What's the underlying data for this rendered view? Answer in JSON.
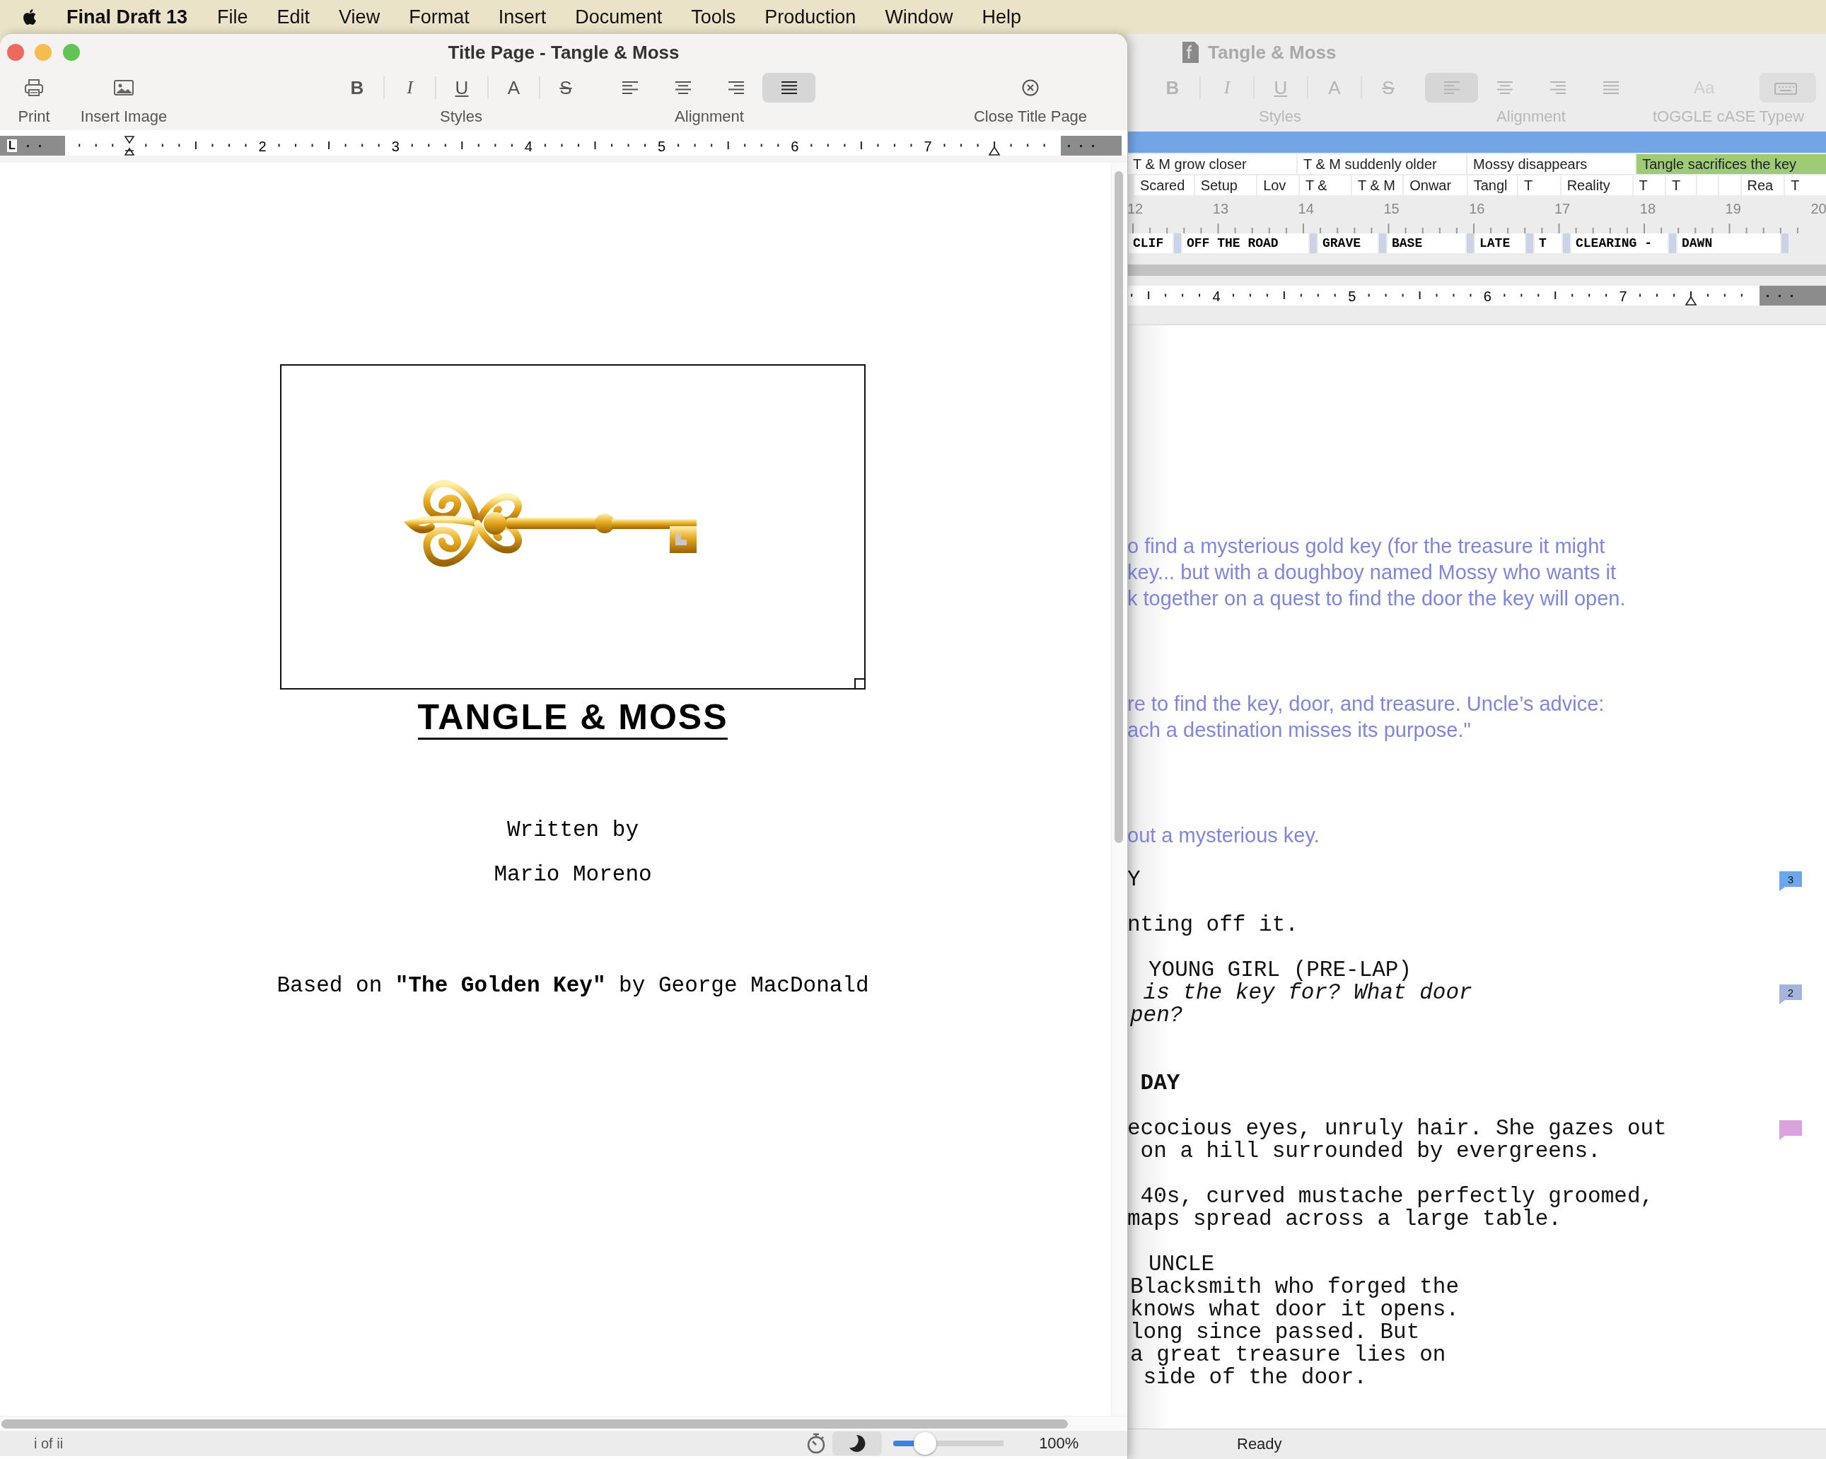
{
  "menu_bar": {
    "app": "Final Draft 13",
    "items": [
      "File",
      "Edit",
      "View",
      "Format",
      "Insert",
      "Document",
      "Tools",
      "Production",
      "Window",
      "Help"
    ]
  },
  "title_window": {
    "title": "Title Page - Tangle & Moss",
    "toolbar": {
      "print": "Print",
      "insert_image": "Insert Image",
      "styles_label": "Styles",
      "styles": [
        "B",
        "I",
        "U",
        "A",
        "S"
      ],
      "alignment_label": "Alignment",
      "alignment": [
        {
          "kind": "left",
          "selected": false
        },
        {
          "kind": "center",
          "selected": false
        },
        {
          "kind": "right",
          "selected": false
        },
        {
          "kind": "justify",
          "selected": true
        }
      ],
      "close": "Close Title Page"
    },
    "ruler": {
      "tab_stop": "L",
      "labels": [
        "2",
        "3",
        "4",
        "5",
        "6",
        "7"
      ]
    },
    "title_page": {
      "title": "TANGLE & MOSS",
      "written_by": "Written by",
      "author": "Mario Moreno",
      "source": "Based on **\"The Golden Key\"** by George MacDonald"
    },
    "status": {
      "page": "i of ii",
      "night_mode": {
        "on": false
      },
      "zoom_slider": {
        "level": 0.29
      },
      "zoom": "100%"
    }
  },
  "script_window": {
    "title": "Tangle & Moss",
    "toolbar": {
      "styles": [
        "B",
        "I",
        "U",
        "A",
        "S"
      ],
      "styles_label": "Styles",
      "alignment": [
        {
          "kind": "left",
          "selected": true
        },
        {
          "kind": "center",
          "selected": false
        },
        {
          "kind": "right",
          "selected": false
        },
        {
          "kind": "justify",
          "selected": false
        }
      ],
      "alignment_label": "Alignment",
      "case_button": "Aa",
      "case_label": "tOGGLE cASE",
      "typewriter_label": "Typew"
    },
    "beats": [
      {
        "label": "T & M grow closer",
        "color": "#ffffff"
      },
      {
        "label": "T & M suddenly older",
        "color": "#ffffff"
      },
      {
        "label": "Mossy disappears",
        "color": "#ffffff"
      },
      {
        "label": "Tangle sacrifices the key",
        "color": "#9dcb76"
      }
    ],
    "cards": [
      {
        "kind": "card",
        "label": "Scared"
      },
      {
        "kind": "card",
        "label": "Setup"
      },
      {
        "kind": "card",
        "label": "Lov"
      },
      {
        "kind": "card",
        "label": "T &"
      },
      {
        "kind": "card",
        "label": "T & M"
      },
      {
        "kind": "card",
        "label": "Onwar"
      },
      {
        "kind": "card",
        "label": "Tangl"
      },
      {
        "kind": "card",
        "label": "T"
      },
      {
        "kind": "card",
        "label": "Reality"
      },
      {
        "kind": "card",
        "label": "T"
      },
      {
        "kind": "card",
        "label": "T"
      },
      {
        "kind": "blank"
      },
      {
        "kind": "blank"
      },
      {
        "kind": "card",
        "label": "Rea"
      },
      {
        "kind": "card",
        "label": "T"
      }
    ],
    "timeline": [
      "12",
      "13",
      "14",
      "15",
      "16",
      "17",
      "18",
      "19",
      "20"
    ],
    "scenes": [
      "CLIF",
      "OFF THE ROAD",
      "GRAVE",
      "BASE",
      "LATE",
      "T",
      "CLEARING -",
      "DAWN"
    ],
    "ruler": {
      "labels": [
        "4",
        "5",
        "6",
        "7"
      ]
    },
    "script": [
      {
        "kind": "summary",
        "lines": [
          "o find a mysterious gold key (for the treasure it might",
          "key... but with a doughboy named Mossy who wants it",
          "k together on a quest to find the door the key will open."
        ]
      },
      {
        "kind": "summary",
        "lines": [
          "re to find the key, door, and treasure. Uncle’s advice:",
          "ach a destination misses its purpose.\""
        ]
      },
      {
        "kind": "summary",
        "lines": [
          "out a mysterious key."
        ]
      },
      {
        "kind": "action",
        "lines": [
          "Y"
        ],
        "note": {
          "label": "3",
          "color": "#6ea6ea"
        }
      },
      {
        "kind": "action",
        "lines": [
          "nting off it."
        ]
      },
      {
        "kind": "character",
        "lines": [
          "YOUNG GIRL (PRE-LAP)"
        ]
      },
      {
        "kind": "dialogue",
        "lines": [
          " is the key for? What door",
          "pen?"
        ],
        "note": {
          "label": "2",
          "color": "#a3b5dd"
        }
      },
      {
        "kind": "heading",
        "lines": [
          " DAY"
        ]
      },
      {
        "kind": "action",
        "lines": [
          "ecocious eyes, unruly hair. She gazes out",
          " on a hill surrounded by evergreens."
        ],
        "note": {
          "color": "#dba3dd"
        }
      },
      {
        "kind": "action",
        "lines": [
          " 40s, curved mustache perfectly groomed,",
          "maps spread across a large table."
        ]
      },
      {
        "kind": "character",
        "lines": [
          "UNCLE"
        ]
      },
      {
        "kind": "speech",
        "lines": [
          "Blacksmith who forged the",
          "knows what door it opens.",
          "long since passed. But",
          "a great treasure lies on",
          " side of the door."
        ]
      }
    ],
    "status": "Ready"
  }
}
